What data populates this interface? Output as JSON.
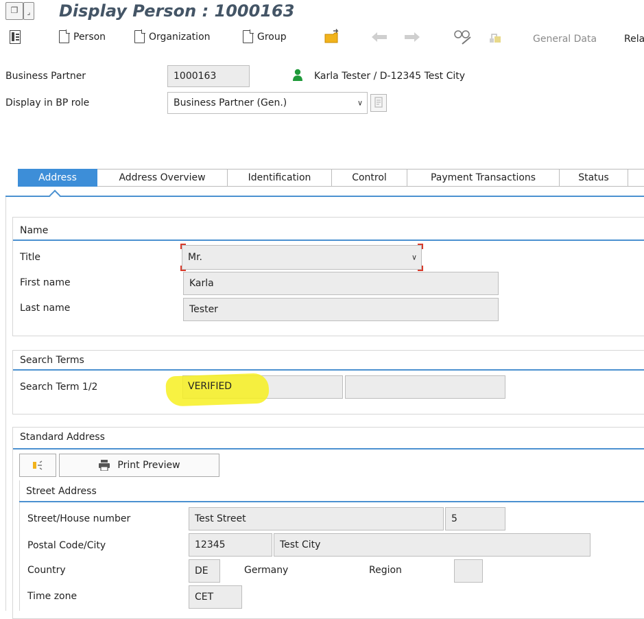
{
  "window": {
    "title": "Display Person : 1000163"
  },
  "toolbar": {
    "person_label": "Person",
    "organization_label": "Organization",
    "group_label": "Group",
    "general_data_label": "General Data",
    "relationships_label": "Rela"
  },
  "header": {
    "bp_label": "Business Partner",
    "bp_value": "1000163",
    "bp_description": "Karla Tester / D-12345 Test City",
    "role_label": "Display in BP role",
    "role_value": "Business Partner (Gen.)"
  },
  "tabs": [
    {
      "label": "Address",
      "active": true
    },
    {
      "label": "Address Overview",
      "active": false
    },
    {
      "label": "Identification",
      "active": false
    },
    {
      "label": "Control",
      "active": false
    },
    {
      "label": "Payment Transactions",
      "active": false
    },
    {
      "label": "Status",
      "active": false
    }
  ],
  "name_group": {
    "title": "Name",
    "title_label": "Title",
    "title_value": "Mr.",
    "first_name_label": "First name",
    "first_name_value": "Karla",
    "last_name_label": "Last name",
    "last_name_value": "Tester"
  },
  "search_group": {
    "title": "Search Terms",
    "term_label": "Search Term 1/2",
    "term1_value": "VERIFIED",
    "term2_value": ""
  },
  "address_group": {
    "title": "Standard Address",
    "print_preview_label": "Print Preview",
    "street_section_title": "Street Address",
    "street_label": "Street/House number",
    "street_value": "Test Street",
    "house_number_value": "5",
    "postal_label": "Postal Code/City",
    "postal_value": "12345",
    "city_value": "Test City",
    "country_label": "Country",
    "country_code": "DE",
    "country_name": "Germany",
    "region_label": "Region",
    "region_value": "",
    "timezone_label": "Time zone",
    "timezone_value": "CET"
  },
  "colors": {
    "accent": "#3d8ed8",
    "title_text": "#445566",
    "highlight": "#f7f021",
    "person_icon": "#1f9a3a"
  }
}
